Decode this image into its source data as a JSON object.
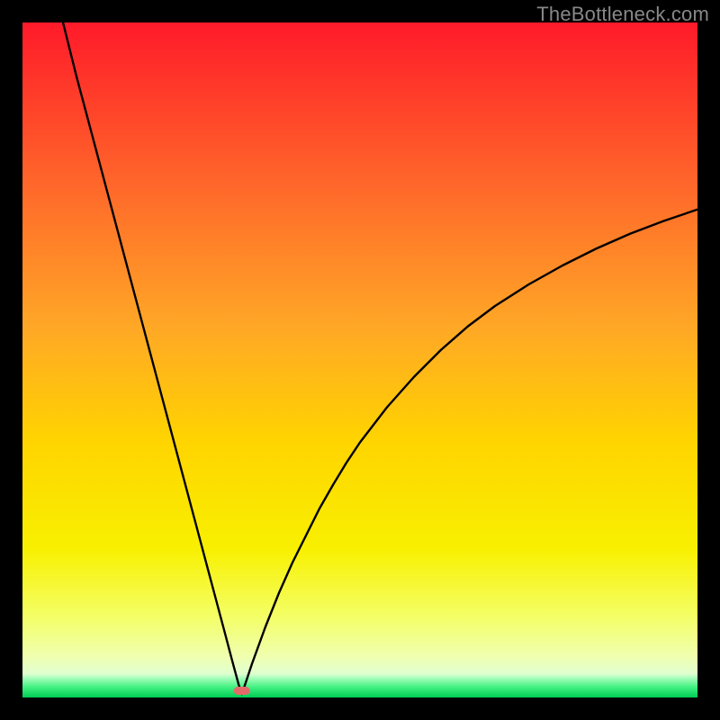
{
  "watermark": "TheBottleneck.com",
  "chart_data": {
    "type": "line",
    "title": "",
    "xlabel": "",
    "ylabel": "",
    "xlim": [
      0,
      100
    ],
    "ylim": [
      0,
      100
    ],
    "grid": false,
    "legend": false,
    "background_gradient": {
      "top_color": "#FF2030",
      "mid_color": "#FFD400",
      "bottom_band_color": "#00E060",
      "bottom_band_start_pct": 97
    },
    "marker": {
      "x": 32.5,
      "y": 1.0,
      "color": "#E46A6A"
    },
    "series": [
      {
        "name": "bottleneck-curve",
        "color": "#000000",
        "x": [
          6,
          8,
          10,
          12,
          14,
          16,
          18,
          20,
          22,
          24,
          26,
          28,
          30,
          31,
          32,
          32.5,
          33,
          34,
          36,
          38,
          40,
          42,
          44,
          46,
          48,
          50,
          54,
          58,
          62,
          66,
          70,
          75,
          80,
          85,
          90,
          95,
          100
        ],
        "y": [
          100,
          92,
          84.5,
          77,
          69.5,
          62,
          54.5,
          47,
          39.5,
          32,
          24.5,
          17,
          9.5,
          5.7,
          2,
          0.5,
          2,
          5,
          10.5,
          15.5,
          20,
          24,
          28,
          31.5,
          34.8,
          37.8,
          43,
          47.5,
          51.5,
          55,
          58,
          61.2,
          64,
          66.5,
          68.7,
          70.6,
          72.3
        ]
      }
    ]
  }
}
